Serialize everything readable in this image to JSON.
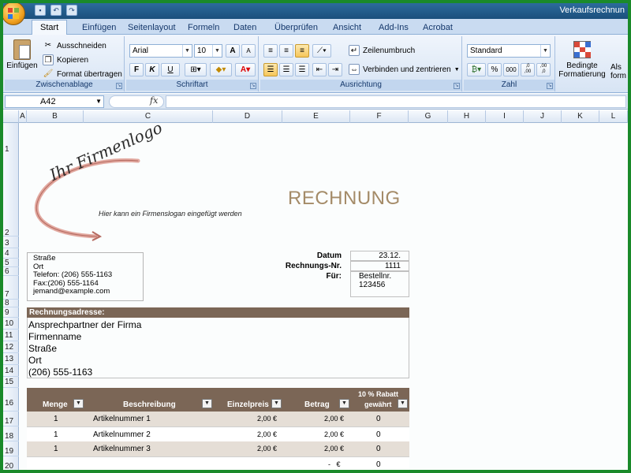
{
  "window": {
    "title": "Verkaufsrechnun"
  },
  "tabs": [
    "Start",
    "Einfügen",
    "Seitenlayout",
    "Formeln",
    "Daten",
    "Überprüfen",
    "Ansicht",
    "Add-Ins",
    "Acrobat"
  ],
  "active_tab": "Start",
  "ribbon": {
    "clipboard": {
      "label": "Zwischenablage",
      "paste": "Einfügen",
      "cut": "Ausschneiden",
      "copy": "Kopieren",
      "format_painter": "Format übertragen"
    },
    "font": {
      "label": "Schriftart",
      "font_name": "Arial",
      "font_size": "10",
      "bold": "F",
      "italic": "K",
      "underline": "U",
      "grow": "A",
      "shrink": "A"
    },
    "alignment": {
      "label": "Ausrichtung",
      "wrap": "Zeilenumbruch",
      "merge": "Verbinden und zentrieren"
    },
    "number": {
      "label": "Zahl",
      "format": "Standard",
      "percent": "%",
      "thousands": "000",
      "inc_decimal": ",0\n,00",
      "dec_decimal": ",00\n,0"
    },
    "styles": {
      "conditional": "Bedingte\nFormatierung",
      "next": "Als\nform"
    }
  },
  "formula_bar": {
    "cell_ref": "A42",
    "fx": "fx",
    "value": ""
  },
  "columns": [
    "A",
    "B",
    "C",
    "D",
    "E",
    "F",
    "G",
    "H",
    "I",
    "J",
    "K",
    "L"
  ],
  "rows": [
    "1",
    "2",
    "3",
    "4",
    "5",
    "6",
    "7",
    "8",
    "9",
    "10",
    "11",
    "12",
    "13",
    "14",
    "15",
    "16",
    "17",
    "18",
    "19",
    "20"
  ],
  "invoice": {
    "logo_text": "Ihr Firmenlogo",
    "slogan": "Hier kann ein Firmenslogan eingefügt werden",
    "title": "RECHNUNG",
    "sender": [
      "Straße",
      "Ort",
      "Telefon: (206) 555-1163",
      "Fax:(206) 555-1164",
      "jemand@example.com"
    ],
    "date_label": "Datum",
    "date_value": "23.12.",
    "number_label": "Rechnungs-Nr.",
    "number_value": "1111",
    "for_label": "Für:",
    "for_lines": [
      "Bestellnr.",
      "123456"
    ],
    "billing_header": "Rechnungsadresse:",
    "billing_lines": [
      "Ansprechpartner der Firma",
      "Firmenname",
      "Straße",
      "Ort",
      "(206) 555-1163"
    ],
    "table_headers": {
      "qty": "Menge",
      "desc": "Beschreibung",
      "unit_price": "Einzelpreis",
      "amount": "Betrag",
      "discount_1": "10 % Rabatt",
      "discount_2": "gewährt"
    },
    "items": [
      {
        "qty": "1",
        "desc": "Artikelnummer 1",
        "unit_price": "2,00 €",
        "amount": "2,00 €",
        "discount": "0"
      },
      {
        "qty": "1",
        "desc": "Artikelnummer 2",
        "unit_price": "2,00 €",
        "amount": "2,00 €",
        "discount": "0"
      },
      {
        "qty": "1",
        "desc": "Artikelnummer 3",
        "unit_price": "2,00 €",
        "amount": "2,00 €",
        "discount": "0"
      }
    ],
    "empty_row": {
      "amount": "-   €",
      "discount": "0"
    }
  },
  "colors": {
    "accent_brown": "#7b6656",
    "title_tan": "#a48b68",
    "row_shade": "#e5ded6"
  }
}
